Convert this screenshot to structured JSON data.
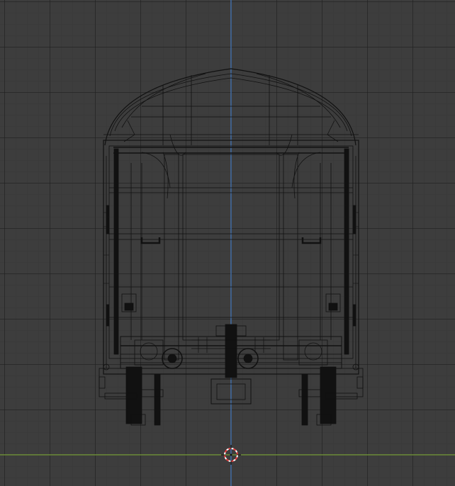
{
  "viewport": {
    "mode": "wireframe",
    "view": "front-orthographic",
    "object": "railway-carriage",
    "colors": {
      "background": "#3d3d3d",
      "wire": "#111111",
      "x_axis": "#7aa13b",
      "z_axis": "#4a7fc4",
      "cursor_red": "#e63c3c",
      "cursor_white": "#ffffff"
    },
    "icons": [
      "3d-cursor-icon"
    ]
  }
}
